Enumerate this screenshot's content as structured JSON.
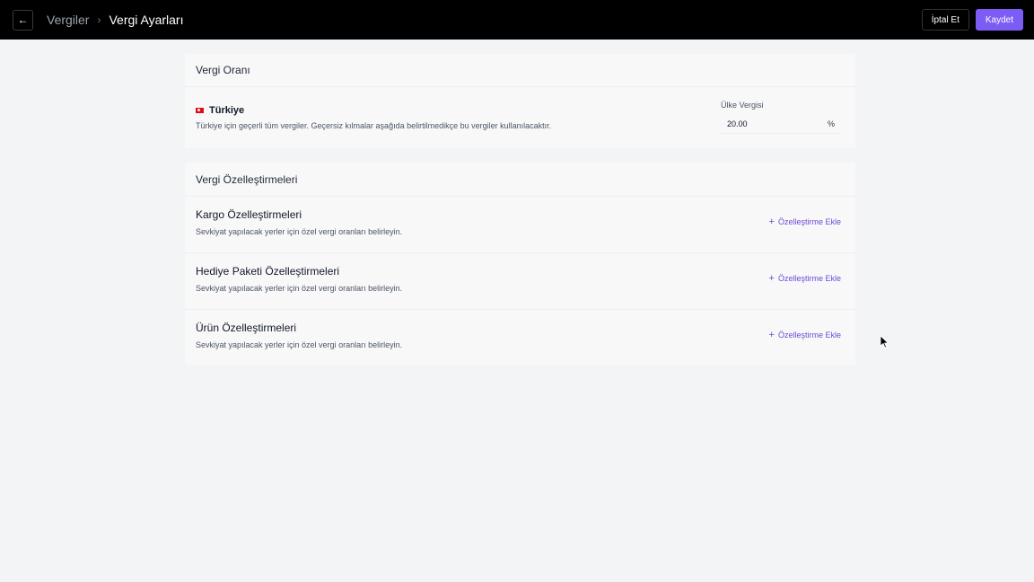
{
  "header": {
    "back_icon": "arrow-left-icon",
    "breadcrumb_parent": "Vergiler",
    "breadcrumb_current": "Vergi Ayarları",
    "cancel_label": "İptal Et",
    "save_label": "Kaydet",
    "accent_color": "#7c5cf5"
  },
  "tax_rate": {
    "title": "Vergi Oranı",
    "country_name": "Türkiye",
    "country_flag": "flag-tr-icon",
    "description": "Türkiye için geçerli tüm vergiler. Geçersiz kılmalar aşağıda belirtilmedikçe bu vergiler kullanılacaktır.",
    "field_label": "Ülke Vergisi",
    "field_value": "20.00",
    "field_unit": "%"
  },
  "overrides": {
    "title": "Vergi Özelleştirmeleri",
    "items": [
      {
        "title": "Kargo Özelleştirmeleri",
        "description": "Sevkiyat yapılacak yerler için özel vergi oranları belirleyin.",
        "action": "Özelleştirme Ekle"
      },
      {
        "title": "Hediye Paketi Özelleştirmeleri",
        "description": "Sevkiyat yapılacak yerler için özel vergi oranları belirleyin.",
        "action": "Özelleştirme Ekle"
      },
      {
        "title": "Ürün Özelleştirmeleri",
        "description": "Sevkiyat yapılacak yerler için özel vergi oranları belirleyin.",
        "action": "Özelleştirme Ekle"
      }
    ]
  }
}
